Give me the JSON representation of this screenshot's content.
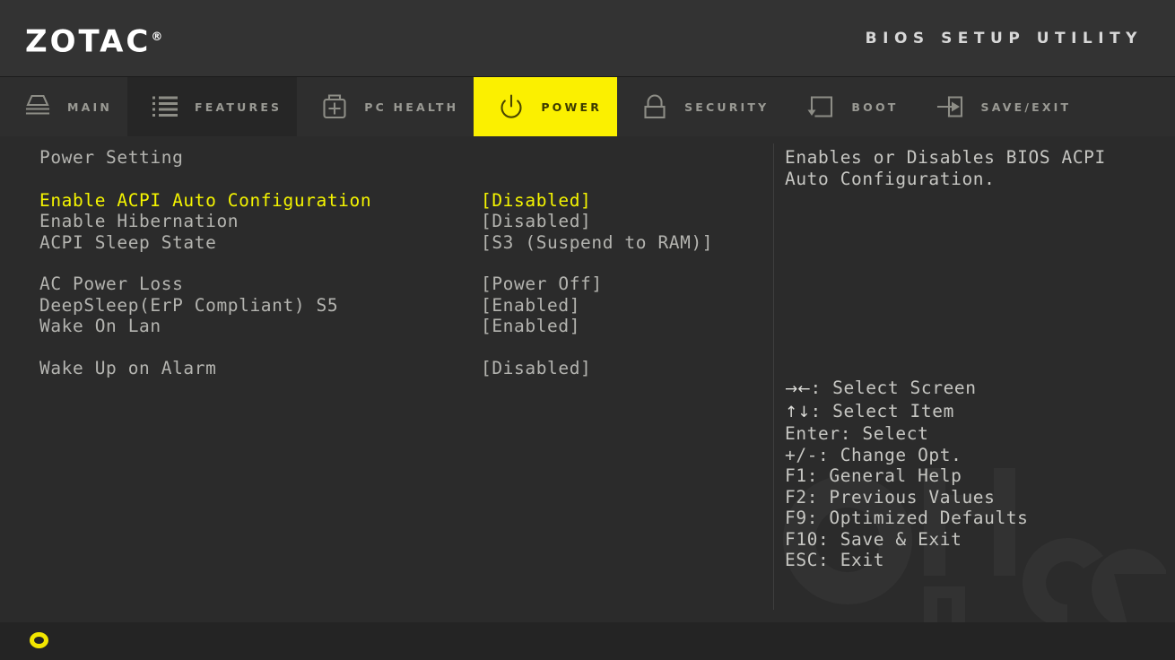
{
  "header": {
    "logo": "ZOTAC",
    "logo_tm": "®",
    "title": "BIOS SETUP UTILITY"
  },
  "tabs": [
    {
      "id": "main",
      "label": "MAIN",
      "icon": "drive-stack-icon",
      "state": "normal"
    },
    {
      "id": "features",
      "label": "FEATURES",
      "icon": "list-icon",
      "state": "hover"
    },
    {
      "id": "pchealth",
      "label": "PC HEALTH",
      "icon": "medkit-plus-icon",
      "state": "normal"
    },
    {
      "id": "power",
      "label": "POWER",
      "icon": "power-icon",
      "state": "active"
    },
    {
      "id": "security",
      "label": "SECURITY",
      "icon": "padlock-icon",
      "state": "normal"
    },
    {
      "id": "boot",
      "label": "BOOT",
      "icon": "boot-return-icon",
      "state": "normal"
    },
    {
      "id": "saveexit",
      "label": "SAVE/EXIT",
      "icon": "arrow-in-box-icon",
      "state": "normal"
    }
  ],
  "main": {
    "section_title": "Power Setting",
    "groups": [
      {
        "rows": [
          {
            "name": "Enable ACPI Auto Configuration",
            "value": "[Disabled]",
            "selected": true
          },
          {
            "name": "Enable Hibernation",
            "value": "[Disabled]",
            "selected": false
          },
          {
            "name": "ACPI Sleep State",
            "value": "[S3 (Suspend to RAM)]",
            "selected": false
          }
        ]
      },
      {
        "rows": [
          {
            "name": "AC Power Loss",
            "value": "[Power Off]",
            "selected": false
          },
          {
            "name": "DeepSleep(ErP Compliant) S5",
            "value": "[Enabled]",
            "selected": false
          },
          {
            "name": "Wake On Lan",
            "value": "[Enabled]",
            "selected": false
          }
        ]
      },
      {
        "rows": [
          {
            "name": "Wake Up on Alarm",
            "value": "[Disabled]",
            "selected": false
          }
        ]
      }
    ]
  },
  "help": {
    "lines": [
      "Enables or Disables BIOS ACPI",
      "Auto Configuration."
    ]
  },
  "legend": [
    {
      "key": "→←",
      "key_is_arrows": true,
      "text": ": Select Screen"
    },
    {
      "key": "↑↓",
      "key_is_arrows": true,
      "text": ": Select Item"
    },
    {
      "key": "Enter",
      "key_is_arrows": false,
      "text": ": Select"
    },
    {
      "key": "+/-",
      "key_is_arrows": false,
      "text": ": Change Opt."
    },
    {
      "key": "F1",
      "key_is_arrows": false,
      "text": ": General Help"
    },
    {
      "key": "F2",
      "key_is_arrows": false,
      "text": ": Previous Values"
    },
    {
      "key": "F9",
      "key_is_arrows": false,
      "text": ": Optimized Defaults"
    },
    {
      "key": "F10",
      "key_is_arrows": false,
      "text": ": Save & Exit"
    },
    {
      "key": "ESC",
      "key_is_arrows": false,
      "text": ": Exit"
    }
  ],
  "footer": {
    "indicator": "ring-indicator"
  },
  "colors": {
    "accent_yellow": "#fbf000",
    "selected_text": "#f5f500",
    "body_bg": "#2b2b2b",
    "header_bg": "#333333",
    "tabbar_bg": "#2e2e2e",
    "footer_bg": "#242424",
    "text_gray": "#b4b4b0"
  }
}
